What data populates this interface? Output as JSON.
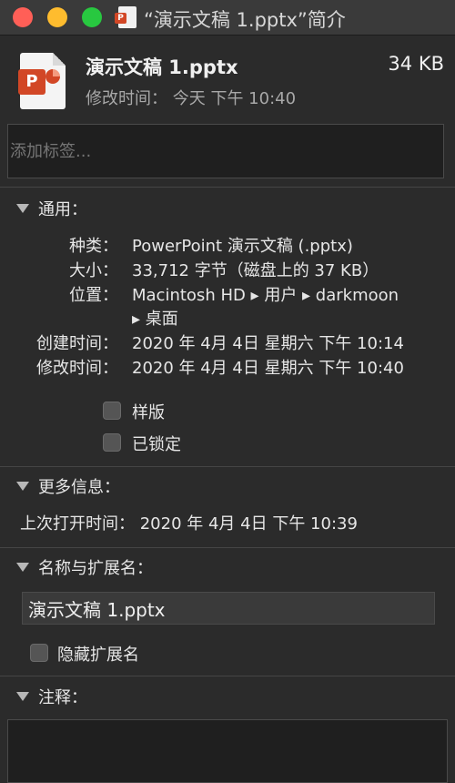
{
  "window": {
    "title": "“演示文稿 1.pptx”简介",
    "title_icon": "powerpoint-file-icon"
  },
  "header": {
    "file_name": "演示文稿 1.pptx",
    "file_size": "34 KB",
    "modified": "修改时间：  今天  下午 10:40",
    "file_icon": "powerpoint-document-icon"
  },
  "tags": {
    "placeholder": "添加标签..."
  },
  "general": {
    "heading": "通用：",
    "kind_label": "种类：",
    "kind_value": "PowerPoint 演示文稿 (.pptx)",
    "size_label": "大小：",
    "size_value": "33,712 字节（磁盘上的 37 KB）",
    "where_label": "位置：",
    "where_value_line1": "Macintosh HD ▸ 用户 ▸ darkmoon",
    "where_value_line2": "▸ 桌面",
    "created_label": "创建时间：",
    "created_value": "2020 年 4月 4日  星期六  下午 10:14",
    "modified_label": "修改时间：",
    "modified_value": "2020 年 4月 4日  星期六  下午 10:40",
    "stationery_label": "样版",
    "locked_label": "已锁定"
  },
  "more_info": {
    "heading": "更多信息：",
    "last_opened": "上次打开时间：  2020 年 4月 4日  下午 10:39"
  },
  "name_ext": {
    "heading": "名称与扩展名：",
    "name_value": "演示文稿 1.pptx",
    "hide_ext_label": "隐藏扩展名"
  },
  "comments": {
    "heading": "注释："
  }
}
